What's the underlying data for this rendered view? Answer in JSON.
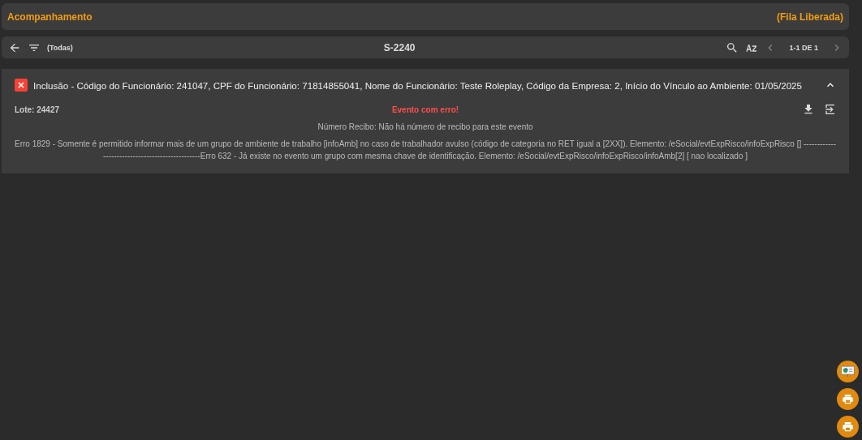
{
  "header": {
    "title": "Acompanhamento",
    "status": "(Fila Liberada)"
  },
  "toolbar": {
    "filter": "(Todas)",
    "title": "S-2240",
    "pagination": "1-1 DE 1"
  },
  "event": {
    "expanded": true,
    "has_error": true,
    "title": "Inclusão - Código do Funcionário: 241047, CPF do Funcionário: 71814855041, Nome do Funcionário: Teste Roleplay, Código da Empresa: 2, Início do Vínculo ao Ambiente: 01/05/2025",
    "lote": "Lote: 24427",
    "status": "Evento com erro!",
    "recibo": "Número Recibo: Não há número de recibo para este evento",
    "error_text": "Erro 1829 - Somente é permitido informar mais de um grupo de ambiente de trabalho [infoAmb] no caso de trabalhador avulso (código de categoria no RET igual a [2XX]). Elemento: /eSocial/evtExpRisco/infoExpRisco [] ------------------------------------------------Erro 632 - Já existe no evento um grupo com mesma chave de identificação. Elemento: /eSocial/evtExpRisco/infoExpRisco/infoAmb[2] [ nao localizado ]"
  },
  "fab": [
    {
      "kind": "presentation"
    },
    {
      "kind": "print"
    },
    {
      "kind": "print"
    }
  ]
}
